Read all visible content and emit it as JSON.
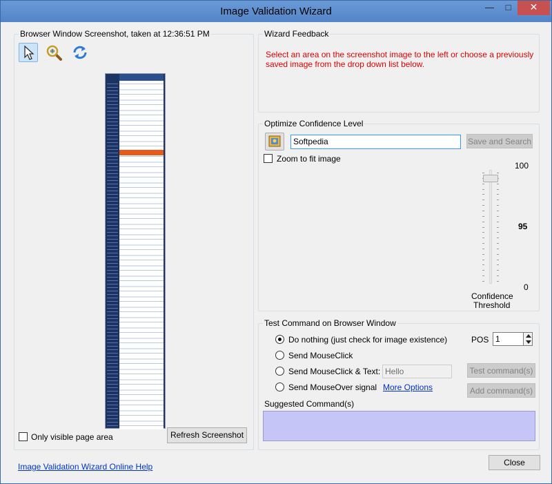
{
  "window": {
    "title": "Image Validation Wizard"
  },
  "titlebar": {
    "minimize": "—",
    "maximize": "□",
    "close": "✕"
  },
  "screenshot_panel": {
    "title": "Browser Window Screenshot, taken at 12:36:51 PM",
    "tools": [
      "pointer-icon",
      "zoom-icon",
      "refresh-icon"
    ],
    "only_visible_label": "Only visible page area",
    "only_visible_checked": false,
    "refresh_button": "Refresh Screenshot"
  },
  "feedback_panel": {
    "title": "Wizard Feedback",
    "message": "Select an area on the screenshot image to the left or choose a previously saved image from the drop down list below.",
    "message_color": "#e00000"
  },
  "confidence_panel": {
    "title": "Optimize Confidence Level",
    "search_value": "Softpedia",
    "save_search_button": "Save and Search",
    "zoom_label": "Zoom to fit image",
    "zoom_checked": false,
    "max_label": "100",
    "current_value": "95",
    "min_label": "0",
    "threshold_label_1": "Confidence",
    "threshold_label_2": "Threshold",
    "threshold_value": 95
  },
  "test_panel": {
    "title": "Test Command on Browser Window",
    "options": [
      {
        "label": "Do nothing (just check for image existence)",
        "checked": true
      },
      {
        "label": "Send MouseClick",
        "checked": false
      },
      {
        "label": "Send MouseClick & Text:",
        "checked": false
      },
      {
        "label": "Send MouseOver signal",
        "checked": false
      }
    ],
    "pos_label": "POS",
    "pos_value": "1",
    "text_value": "Hello",
    "more_options": "More Options",
    "test_button": "Test command(s)",
    "add_button": "Add command(s)",
    "suggested_label": "Suggested Command(s)",
    "suggested_bg": "#c5c5f8"
  },
  "footer": {
    "help_link": "Image Validation Wizard Online Help",
    "close_button": "Close"
  }
}
